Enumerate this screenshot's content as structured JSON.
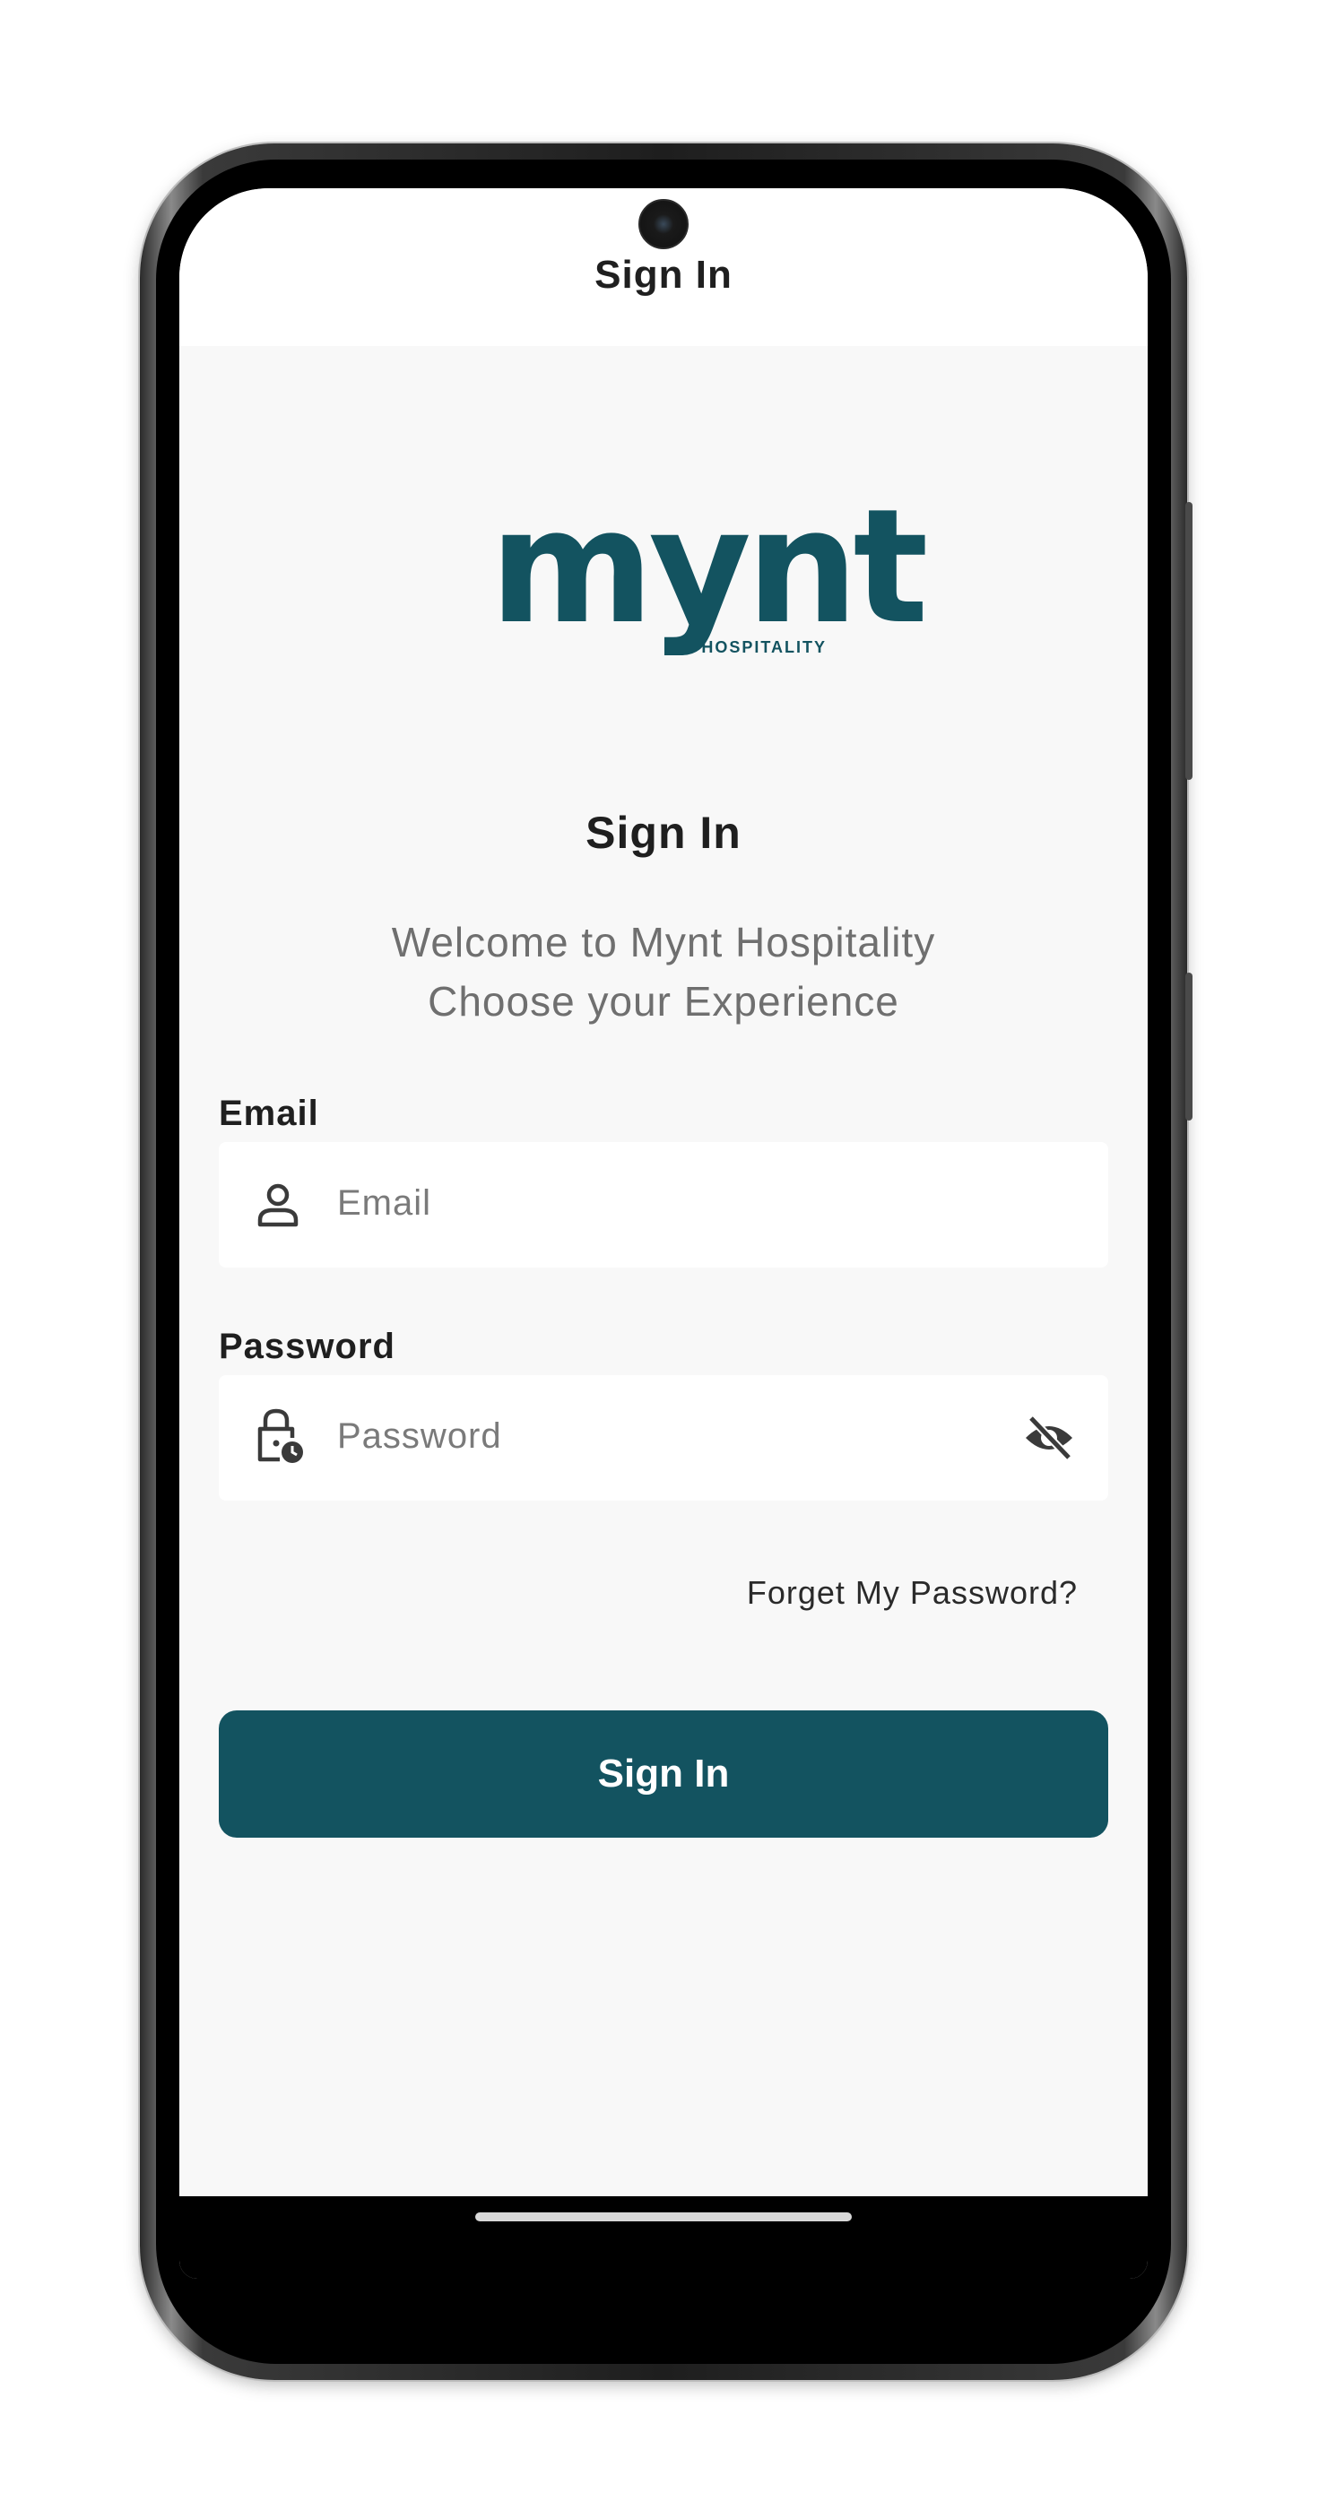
{
  "header": {
    "title": "Sign In"
  },
  "logo": {
    "wordmark": "mynt",
    "tagline": "HOSPITALITY",
    "color": "#135360"
  },
  "main": {
    "title": "Sign In",
    "welcome_line1": "Welcome to Mynt Hospitality",
    "welcome_line2": "Choose your Experience"
  },
  "email": {
    "label": "Email",
    "placeholder": "Email",
    "icon": "user-icon"
  },
  "password": {
    "label": "Password",
    "placeholder": "Password",
    "icon": "lock-clock-icon",
    "toggle_icon": "eye-off-icon"
  },
  "forgot_password": "Forget My Password?",
  "signin_button": "Sign In",
  "colors": {
    "primary": "#135360",
    "background": "#f8f8f8",
    "field_background": "#ffffff"
  }
}
